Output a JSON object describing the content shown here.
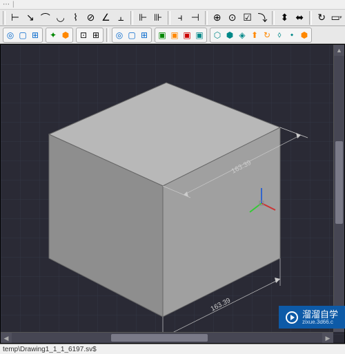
{
  "toolbar1": {
    "icons": [
      "dim-linear",
      "dim-aligned",
      "dim-arc",
      "dim-radius",
      "dim-diameter",
      "dim-angle",
      "dim-ordinate",
      "dim-quick",
      "dim-baseline",
      "dim-continue",
      "dim-space",
      "dim-break",
      "dim-tolerance",
      "dim-center",
      "dim-edit",
      "dim-align-text",
      "dim-style",
      "dim-update"
    ]
  },
  "toolbar2": {
    "group1": [
      "donut-blue",
      "rect-blue",
      "plus-blue"
    ],
    "group2": [
      "ucs-icon",
      "cube-icon"
    ],
    "group3": [
      "layer-a",
      "layer-b"
    ],
    "group4": [
      "donut-blue2",
      "rect-blue2",
      "plus-blue2"
    ],
    "group5": [
      "box-green",
      "box-orange",
      "box-red",
      "box-teal"
    ],
    "group6": [
      "union",
      "subtract",
      "intersect",
      "extrude",
      "revolve",
      "sweep",
      "loft",
      "press"
    ]
  },
  "viewport": {
    "dimensions": {
      "width": "163.39",
      "depth": "163.39"
    },
    "colors": {
      "cube_top": "#b8b8b8",
      "cube_left": "#8e8e8e",
      "cube_right": "#a0a0a0",
      "dim_line": "#cccccc"
    }
  },
  "statusbar": {
    "text": "temp\\Drawing1_1_1_6197.sv$"
  },
  "watermark": {
    "title": "溜溜自学",
    "subtitle": "zixue.3d66.c"
  },
  "menu": {
    "items": [
      "…",
      "|",
      "≡"
    ]
  }
}
